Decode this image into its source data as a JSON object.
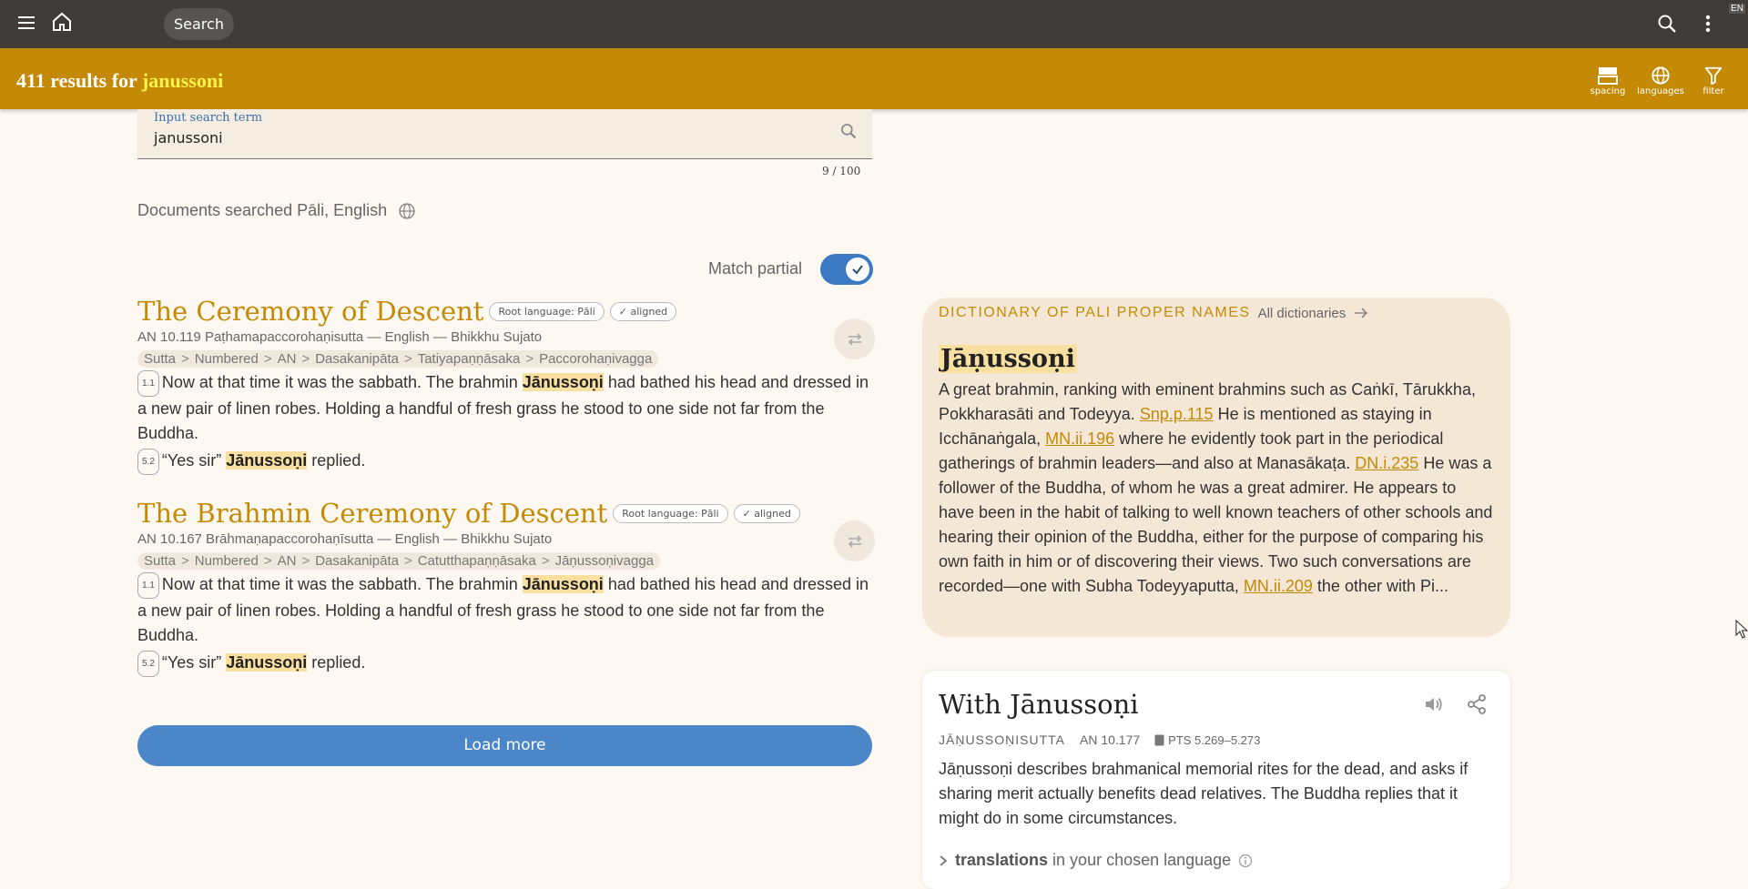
{
  "topbar": {
    "search_label": "Search",
    "lang_code": "EN"
  },
  "results_bar": {
    "count_text": "411 results for ",
    "term": "janussoni",
    "tools": [
      {
        "label": "spacing"
      },
      {
        "label": "languages"
      },
      {
        "label": "filter"
      }
    ]
  },
  "search": {
    "label": "Input search term",
    "value": "janussoni",
    "counter": "9 / 100",
    "docs_searched": "Documents searched Pāli, English",
    "match_partial_label": "Match partial",
    "match_partial_on": true
  },
  "results": [
    {
      "title": "The Ceremony of Descent",
      "badges": [
        "Root language: Pāli",
        "✓ aligned"
      ],
      "meta": "AN 10.119 Paṭhamapaccorohaṇisutta — English — Bhikkhu Sujato",
      "crumbs": [
        "Sutta",
        "Numbered",
        "AN",
        "Dasakanipāta",
        "Tatiyapaṇṇāsaka",
        "Paccorohaṇivagga"
      ],
      "seg1": "1.1",
      "text1_a": "Now at that time it was the sabbath. The brahmin ",
      "hl": "Jānussoṇi",
      "text1_b": " had bathed his head and dressed in a new pair of linen robes. Holding a handful of fresh grass he stood to one side not far from the Buddha.",
      "seg2": "5.2",
      "text2_a": "“Yes sir” ",
      "text2_b": " replied."
    },
    {
      "title": "The Brahmin Ceremony of Descent",
      "badges": [
        "Root language: Pāli",
        "✓ aligned"
      ],
      "meta": "AN 10.167 Brāhmaṇapaccorohaṇīsutta — English — Bhikkhu Sujato",
      "crumbs": [
        "Sutta",
        "Numbered",
        "AN",
        "Dasakanipāta",
        "Catutthapaṇṇāsaka",
        "Jāṇussoṇivagga"
      ],
      "seg1": "1.1",
      "text1_a": "Now at that time it was the sabbath. The brahmin ",
      "hl": "Jānussoṇi",
      "text1_b": " had bathed his head and dressed in a new pair of linen robes. Holding a handful of fresh grass he stood to one side not far from the Buddha.",
      "seg2": "5.2",
      "text2_a": "“Yes sir” ",
      "text2_b": " replied."
    }
  ],
  "load_more": "Load more",
  "dictionary": {
    "name": "DICTIONARY OF PALI PROPER NAMES",
    "all_link": "All dictionaries",
    "term": "Jāṇussoṇi",
    "p1": "A great brahmin, ranking with eminent brahmins such as Caṅkī, Tārukkha, Pokkharasāti and Todeyya. ",
    "link1": "Snp.p.115",
    "p2": " He is mentioned as staying in Icchānaṅgala, ",
    "link2": "MN.ii.196",
    "p3": " where he evidently took part in the periodical gatherings of brahmin leaders—and also at Manasākaṭa. ",
    "link3": "DN.i.235",
    "p4": " He was a follower of the Buddha, of whom he was a great admirer. He appears to have been in the habit of talking to well known teachers of other schools and hearing their opinion of the Buddha, either for the purpose of comparing his own faith in him or of discovering their views. Two such conversations are recorded—one with Subha Todeyyaputta, ",
    "link4": "MN.ii.209",
    "p5": " the other with Pi..."
  },
  "sutta": {
    "title": "With Jānussoṇi",
    "acronym": "JĀṆUSSOṆISUTTA",
    "ref": "AN 10.177",
    "pts": "PTS 5.269–5.273",
    "blurb": "Jāṇussoṇi describes brahmanical memorial rites for the dead, and asks if sharing merit actually benefits dead relatives. The Buddha replies that it might do in some circumstances.",
    "translations_bold": "translations",
    "translations_rest": "in your chosen language"
  },
  "colors": {
    "topbar": "#3e3b39",
    "accent": "#c58a05",
    "highlight_term": "#fff34a",
    "button_blue": "#4a86c8",
    "page_bg": "#fdf8f1"
  }
}
